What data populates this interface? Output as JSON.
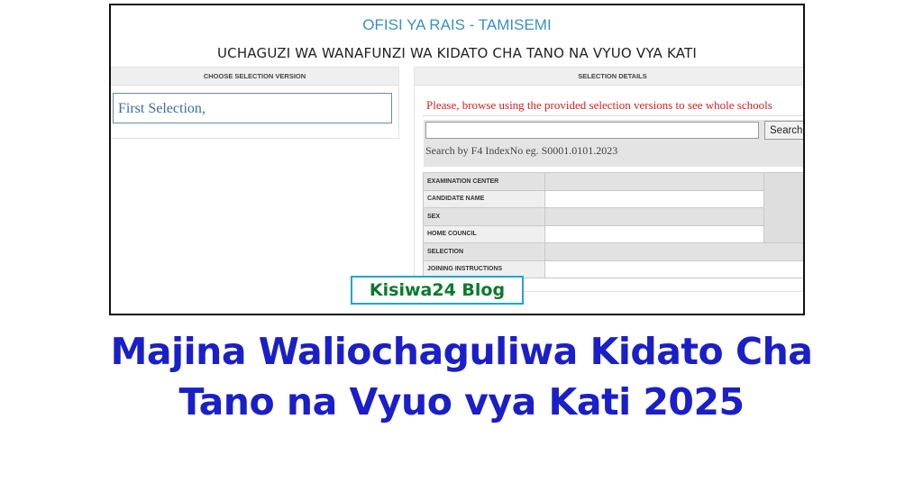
{
  "header": {
    "org_title": "OFISI YA RAIS - TAMISEMI",
    "main_heading": "UCHAGUZI WA WANAFUNZI WA KIDATO CHA TANO NA VYUO VYA KATI"
  },
  "left_panel": {
    "header": "CHOOSE SELECTION VERSION",
    "version_item": "First Selection,"
  },
  "right_panel": {
    "header": "SELECTION DETAILS",
    "notice": "Please, browse using the provided selection versions to see whole schools",
    "search": {
      "value": "",
      "placeholder": "",
      "button_label": "Search",
      "hint": "Search by F4 IndexNo eg. S0001.0101.2023"
    },
    "table_rows": [
      "EXAMINATION CENTER",
      "CANDIDATE NAME",
      "SEX",
      "HOME COUNCIL",
      "SELECTION",
      "JOINING INSTRUCTIONS"
    ]
  },
  "watermark": "Kisiwa24 Blog",
  "page_title": {
    "line1": "Majina Waliochaguliwa Kidato Cha",
    "line2": "Tano na Vyuo vya Kati 2025"
  },
  "colors": {
    "title_blue": "#1a1fc8",
    "notice_red": "#d62020",
    "org_blue": "#3a8fc8",
    "watermark_green": "#0a7a2c",
    "watermark_border": "#1fa3e0"
  }
}
